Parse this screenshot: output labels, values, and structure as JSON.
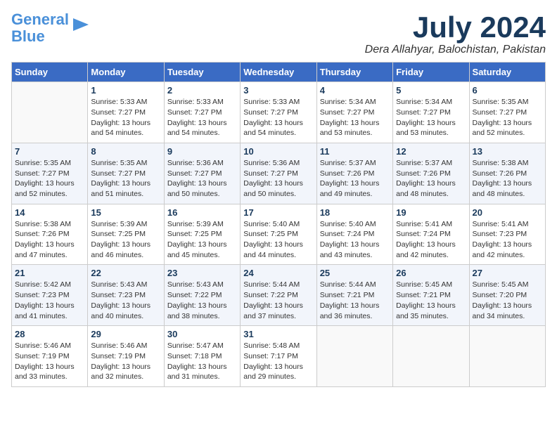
{
  "logo": {
    "line1": "General",
    "line2": "Blue"
  },
  "title": "July 2024",
  "subtitle": "Dera Allahyar, Balochistan, Pakistan",
  "days_of_week": [
    "Sunday",
    "Monday",
    "Tuesday",
    "Wednesday",
    "Thursday",
    "Friday",
    "Saturday"
  ],
  "weeks": [
    [
      {
        "day": "",
        "info": ""
      },
      {
        "day": "1",
        "info": "Sunrise: 5:33 AM\nSunset: 7:27 PM\nDaylight: 13 hours\nand 54 minutes."
      },
      {
        "day": "2",
        "info": "Sunrise: 5:33 AM\nSunset: 7:27 PM\nDaylight: 13 hours\nand 54 minutes."
      },
      {
        "day": "3",
        "info": "Sunrise: 5:33 AM\nSunset: 7:27 PM\nDaylight: 13 hours\nand 54 minutes."
      },
      {
        "day": "4",
        "info": "Sunrise: 5:34 AM\nSunset: 7:27 PM\nDaylight: 13 hours\nand 53 minutes."
      },
      {
        "day": "5",
        "info": "Sunrise: 5:34 AM\nSunset: 7:27 PM\nDaylight: 13 hours\nand 53 minutes."
      },
      {
        "day": "6",
        "info": "Sunrise: 5:35 AM\nSunset: 7:27 PM\nDaylight: 13 hours\nand 52 minutes."
      }
    ],
    [
      {
        "day": "7",
        "info": "Sunrise: 5:35 AM\nSunset: 7:27 PM\nDaylight: 13 hours\nand 52 minutes."
      },
      {
        "day": "8",
        "info": "Sunrise: 5:35 AM\nSunset: 7:27 PM\nDaylight: 13 hours\nand 51 minutes."
      },
      {
        "day": "9",
        "info": "Sunrise: 5:36 AM\nSunset: 7:27 PM\nDaylight: 13 hours\nand 50 minutes."
      },
      {
        "day": "10",
        "info": "Sunrise: 5:36 AM\nSunset: 7:27 PM\nDaylight: 13 hours\nand 50 minutes."
      },
      {
        "day": "11",
        "info": "Sunrise: 5:37 AM\nSunset: 7:26 PM\nDaylight: 13 hours\nand 49 minutes."
      },
      {
        "day": "12",
        "info": "Sunrise: 5:37 AM\nSunset: 7:26 PM\nDaylight: 13 hours\nand 48 minutes."
      },
      {
        "day": "13",
        "info": "Sunrise: 5:38 AM\nSunset: 7:26 PM\nDaylight: 13 hours\nand 48 minutes."
      }
    ],
    [
      {
        "day": "14",
        "info": "Sunrise: 5:38 AM\nSunset: 7:26 PM\nDaylight: 13 hours\nand 47 minutes."
      },
      {
        "day": "15",
        "info": "Sunrise: 5:39 AM\nSunset: 7:25 PM\nDaylight: 13 hours\nand 46 minutes."
      },
      {
        "day": "16",
        "info": "Sunrise: 5:39 AM\nSunset: 7:25 PM\nDaylight: 13 hours\nand 45 minutes."
      },
      {
        "day": "17",
        "info": "Sunrise: 5:40 AM\nSunset: 7:25 PM\nDaylight: 13 hours\nand 44 minutes."
      },
      {
        "day": "18",
        "info": "Sunrise: 5:40 AM\nSunset: 7:24 PM\nDaylight: 13 hours\nand 43 minutes."
      },
      {
        "day": "19",
        "info": "Sunrise: 5:41 AM\nSunset: 7:24 PM\nDaylight: 13 hours\nand 42 minutes."
      },
      {
        "day": "20",
        "info": "Sunrise: 5:41 AM\nSunset: 7:23 PM\nDaylight: 13 hours\nand 42 minutes."
      }
    ],
    [
      {
        "day": "21",
        "info": "Sunrise: 5:42 AM\nSunset: 7:23 PM\nDaylight: 13 hours\nand 41 minutes."
      },
      {
        "day": "22",
        "info": "Sunrise: 5:43 AM\nSunset: 7:23 PM\nDaylight: 13 hours\nand 40 minutes."
      },
      {
        "day": "23",
        "info": "Sunrise: 5:43 AM\nSunset: 7:22 PM\nDaylight: 13 hours\nand 38 minutes."
      },
      {
        "day": "24",
        "info": "Sunrise: 5:44 AM\nSunset: 7:22 PM\nDaylight: 13 hours\nand 37 minutes."
      },
      {
        "day": "25",
        "info": "Sunrise: 5:44 AM\nSunset: 7:21 PM\nDaylight: 13 hours\nand 36 minutes."
      },
      {
        "day": "26",
        "info": "Sunrise: 5:45 AM\nSunset: 7:21 PM\nDaylight: 13 hours\nand 35 minutes."
      },
      {
        "day": "27",
        "info": "Sunrise: 5:45 AM\nSunset: 7:20 PM\nDaylight: 13 hours\nand 34 minutes."
      }
    ],
    [
      {
        "day": "28",
        "info": "Sunrise: 5:46 AM\nSunset: 7:19 PM\nDaylight: 13 hours\nand 33 minutes."
      },
      {
        "day": "29",
        "info": "Sunrise: 5:46 AM\nSunset: 7:19 PM\nDaylight: 13 hours\nand 32 minutes."
      },
      {
        "day": "30",
        "info": "Sunrise: 5:47 AM\nSunset: 7:18 PM\nDaylight: 13 hours\nand 31 minutes."
      },
      {
        "day": "31",
        "info": "Sunrise: 5:48 AM\nSunset: 7:17 PM\nDaylight: 13 hours\nand 29 minutes."
      },
      {
        "day": "",
        "info": ""
      },
      {
        "day": "",
        "info": ""
      },
      {
        "day": "",
        "info": ""
      }
    ]
  ]
}
